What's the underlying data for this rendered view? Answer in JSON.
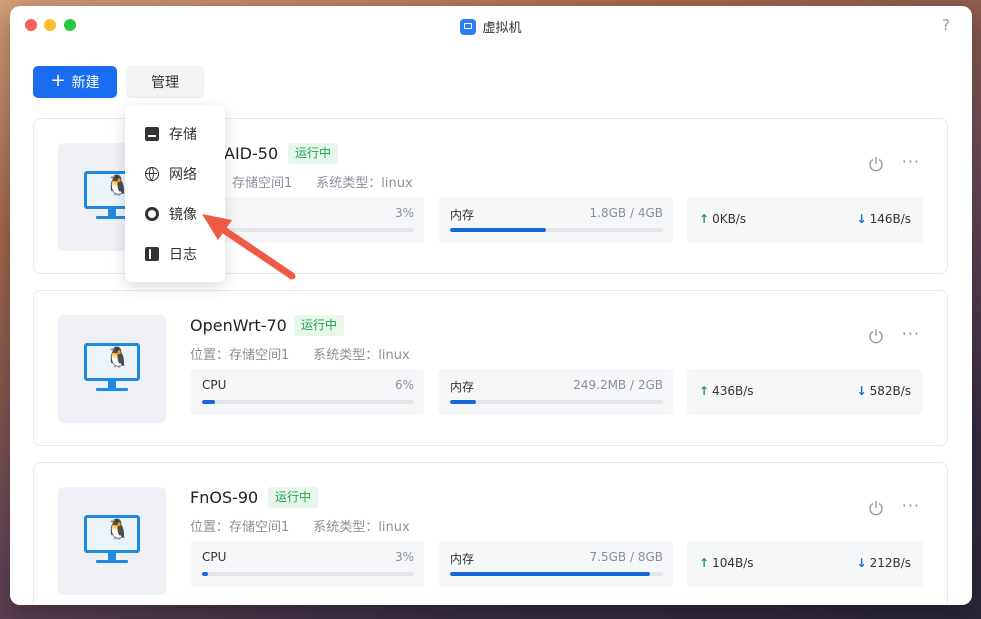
{
  "window": {
    "title": "虚拟机",
    "help": "?"
  },
  "toolbar": {
    "new_label": "新建",
    "new_icon": "+",
    "manage_label": "管理"
  },
  "dropdown": {
    "items": [
      {
        "label": "存储",
        "icon": "storage-icon"
      },
      {
        "label": "网络",
        "icon": "globe-icon"
      },
      {
        "label": "镜像",
        "icon": "disc-icon"
      },
      {
        "label": "日志",
        "icon": "book-icon"
      }
    ]
  },
  "vms": [
    {
      "name": "AID-50",
      "status": "运行中",
      "location": "存储空间1",
      "os_type": "linux",
      "cpu": {
        "label": "",
        "value": "3%",
        "level": 0.03
      },
      "mem": {
        "label": "内存",
        "value": "1.8GB / 4GB",
        "level": 0.45
      },
      "net": {
        "up": "0KB/s",
        "down": "146B/s"
      }
    },
    {
      "name": "OpenWrt-70",
      "status": "运行中",
      "location": "位置：存储空间1",
      "os_type": "系统类型：linux",
      "cpu": {
        "label": "CPU",
        "value": "6%",
        "level": 0.06
      },
      "mem": {
        "label": "内存",
        "value": "249.2MB / 2GB",
        "level": 0.12
      },
      "net": {
        "up": "436B/s",
        "down": "582B/s"
      }
    },
    {
      "name": "FnOS-90",
      "status": "运行中",
      "location": "位置：存储空间1",
      "os_type": "系统类型：linux",
      "cpu": {
        "label": "CPU",
        "value": "3%",
        "level": 0.03
      },
      "mem": {
        "label": "内存",
        "value": "7.5GB / 8GB",
        "level": 0.94
      },
      "net": {
        "up": "104B/s",
        "down": "212B/s"
      }
    }
  ],
  "meta_labels": {
    "os_type_prefix": "系统类型："
  },
  "colors": {
    "accent": "#1a6cf0",
    "status_green": "#22a34a",
    "arrow": "#ef5a45"
  }
}
